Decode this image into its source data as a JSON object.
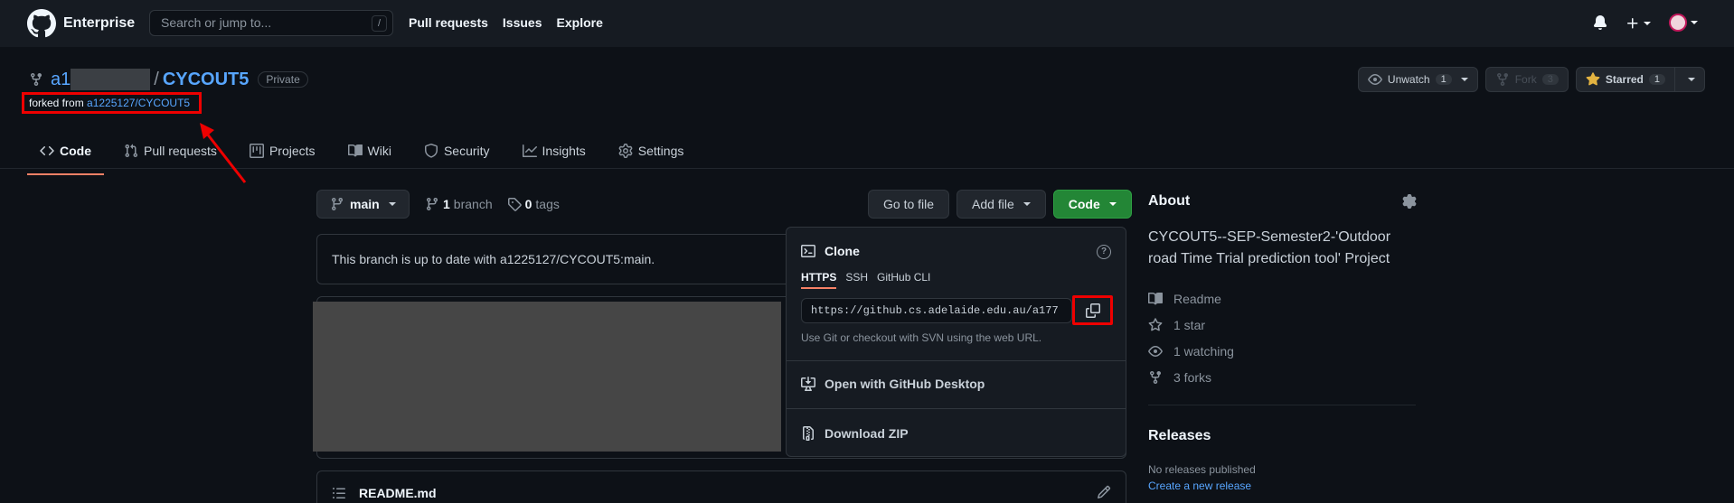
{
  "header": {
    "brand": "Enterprise",
    "search_placeholder": "Search or jump to...",
    "search_shortcut": "/",
    "nav": [
      "Pull requests",
      "Issues",
      "Explore"
    ]
  },
  "repo": {
    "owner_visible": "a1",
    "separator": "/",
    "name": "CYCOUT5",
    "visibility": "Private",
    "forked_prefix": "forked from ",
    "forked_from": "a1225127/CYCOUT5",
    "actions": {
      "watch_label": "Unwatch",
      "watch_count": "1",
      "fork_label": "Fork",
      "fork_count": "3",
      "star_label": "Starred",
      "star_count": "1"
    }
  },
  "tabs": [
    "Code",
    "Pull requests",
    "Projects",
    "Wiki",
    "Security",
    "Insights",
    "Settings"
  ],
  "main": {
    "branch": "main",
    "branch_count": "1",
    "branch_word": "branch",
    "tag_count": "0",
    "tag_word": "tags",
    "go_to_file": "Go to file",
    "add_file": "Add file",
    "code": "Code",
    "up_to_date": "This branch is up to date with a1225127/CYCOUT5:main.",
    "readme": "README.md"
  },
  "clone": {
    "title": "Clone",
    "help": "?",
    "tabs": [
      "HTTPS",
      "SSH",
      "GitHub CLI"
    ],
    "url": "https://github.cs.adelaide.edu.au/a177",
    "hint": "Use Git or checkout with SVN using the web URL.",
    "desktop": "Open with GitHub Desktop",
    "zip": "Download ZIP"
  },
  "about": {
    "title": "About",
    "description": "CYCOUT5--SEP-Semester2-'Outdoor road Time Trial prediction tool' Project",
    "readme": "Readme",
    "stars": "1 star",
    "watching": "1 watching",
    "forks": "3 forks"
  },
  "releases": {
    "title": "Releases",
    "none": "No releases published",
    "create": "Create a new release"
  },
  "colors": {
    "accent_link": "#58a6ff",
    "code_button": "#238636",
    "annotation_red": "#e00000",
    "background": "#0d1117"
  }
}
